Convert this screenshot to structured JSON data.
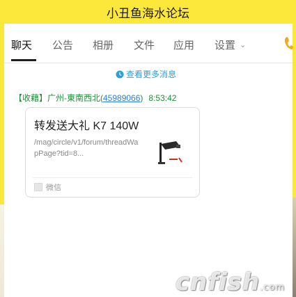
{
  "window": {
    "title": "小丑鱼海水论坛"
  },
  "tabs": [
    {
      "label": "聊天",
      "active": true
    },
    {
      "label": "公告"
    },
    {
      "label": "相册"
    },
    {
      "label": "文件"
    },
    {
      "label": "应用"
    },
    {
      "label": "设置"
    }
  ],
  "chat": {
    "more_link": "查看更多消息",
    "message": {
      "sender_prefix": "【收藉】广州-東南西北(",
      "qq": "45989066",
      "sender_suffix": ")",
      "time": "8:53:42",
      "card": {
        "title": "转发送大礼 K7 140W",
        "url": "/mag/circle/v1/forum/threadWapPage?tid=8...",
        "app": "微信",
        "thumbnail_icon": "product-thumbnail-icon"
      }
    }
  },
  "watermark": {
    "text": "cnfish",
    "suffix": ".com"
  },
  "colors": {
    "title_bar": "#fce83a",
    "link_blue": "#2a9fd8",
    "sender_green": "#1f8f3a",
    "phone_icon": "#f2a81d"
  }
}
